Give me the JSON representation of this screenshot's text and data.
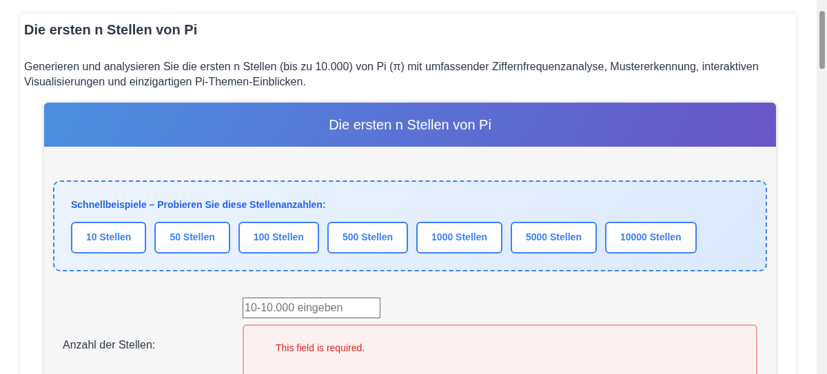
{
  "page": {
    "title": "Die ersten n Stellen von Pi",
    "description": "Generieren und analysieren Sie die ersten n Stellen (bis zu 10.000) von Pi (π) mit umfassender Ziffernfrequenzanalyse, Mustererkennung, interaktiven Visualisierungen und einzigartigen Pi-Themen-Einblicken."
  },
  "tool": {
    "header": "Die ersten n Stellen von Pi",
    "quick_examples": {
      "label": "Schnellbeispiele – Probieren Sie diese Stellenanzahlen:",
      "buttons": [
        "10 Stellen",
        "50 Stellen",
        "100 Stellen",
        "500 Stellen",
        "1000 Stellen",
        "5000 Stellen",
        "10000 Stellen"
      ]
    },
    "form": {
      "label": "Anzahl der Stellen:",
      "placeholder": "10-10.000 eingeben",
      "error": "This field is required."
    }
  }
}
